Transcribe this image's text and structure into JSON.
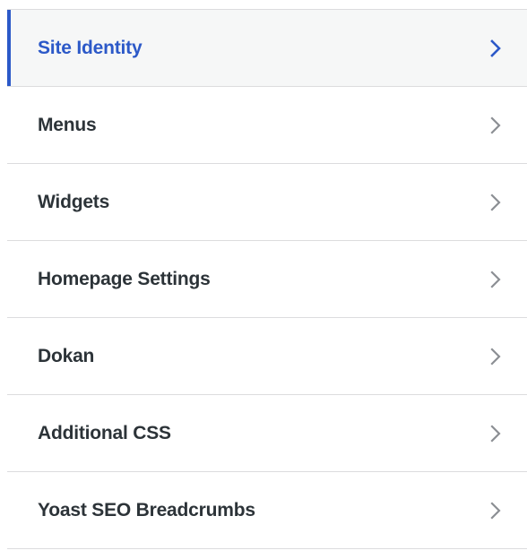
{
  "panel": {
    "items": [
      {
        "label": "Site Identity",
        "active": true,
        "icon": "chevron-right-icon"
      },
      {
        "label": "Menus",
        "active": false,
        "icon": "chevron-right-icon"
      },
      {
        "label": "Widgets",
        "active": false,
        "icon": "chevron-right-icon"
      },
      {
        "label": "Homepage Settings",
        "active": false,
        "icon": "chevron-right-icon"
      },
      {
        "label": "Dokan",
        "active": false,
        "icon": "chevron-right-icon"
      },
      {
        "label": "Additional CSS",
        "active": false,
        "icon": "chevron-right-icon"
      },
      {
        "label": "Yoast SEO Breadcrumbs",
        "active": false,
        "icon": "chevron-right-icon"
      }
    ]
  },
  "colors": {
    "accent": "#2c59c8",
    "text": "#2c3338",
    "chevron": "#8c8f94",
    "divider": "#dcdcde",
    "active_background": "#f6f7f7"
  }
}
